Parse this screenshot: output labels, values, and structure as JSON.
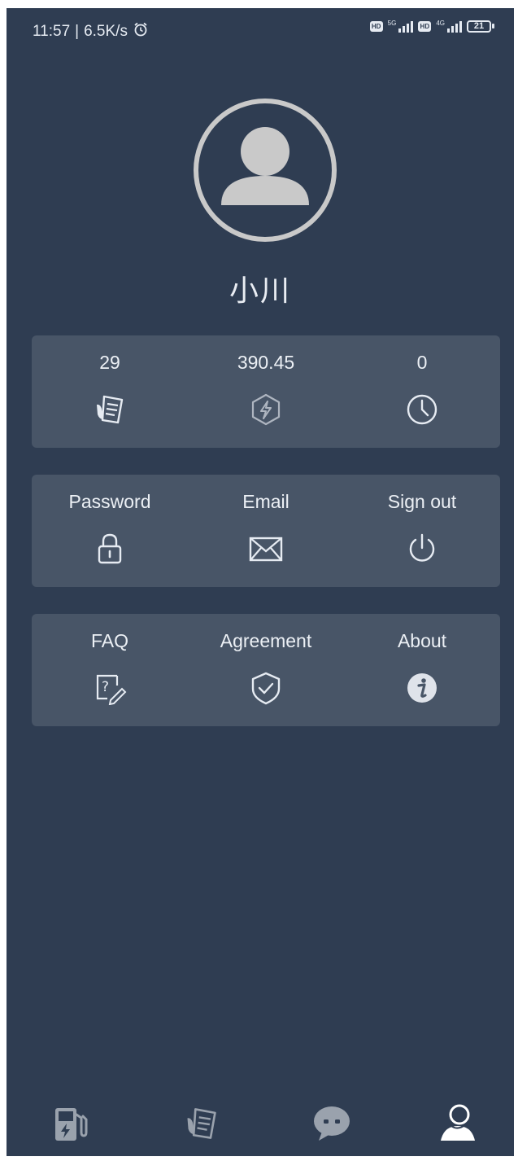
{
  "status_bar": {
    "time": "11:57",
    "speed": "6.5K/s",
    "hd1": "HD",
    "net1": "5G",
    "hd2": "HD",
    "net2": "4G",
    "battery": "21"
  },
  "profile": {
    "username": "小川"
  },
  "stats": [
    {
      "value": "29",
      "icon": "orders-icon"
    },
    {
      "value": "390.45",
      "icon": "energy-icon"
    },
    {
      "value": "0",
      "icon": "clock-icon"
    }
  ],
  "account_actions": [
    {
      "label": "Password",
      "icon": "lock-icon"
    },
    {
      "label": "Email",
      "icon": "envelope-icon"
    },
    {
      "label": "Sign out",
      "icon": "power-icon"
    }
  ],
  "info_actions": [
    {
      "label": "FAQ",
      "icon": "faq-icon"
    },
    {
      "label": "Agreement",
      "icon": "shield-check-icon"
    },
    {
      "label": "About",
      "icon": "info-icon"
    }
  ],
  "tab_bar": [
    {
      "name": "charging-station",
      "icon": "charging-station-icon",
      "active": false
    },
    {
      "name": "orders",
      "icon": "orders-icon",
      "active": false
    },
    {
      "name": "messages",
      "icon": "chat-bubble-icon",
      "active": false
    },
    {
      "name": "profile",
      "icon": "user-icon",
      "active": true
    }
  ],
  "colors": {
    "background": "#2f3d52",
    "card": "#485567",
    "text": "#ecf0f5",
    "icon_inactive": "#9aa2ad",
    "icon_active": "#ffffff"
  }
}
